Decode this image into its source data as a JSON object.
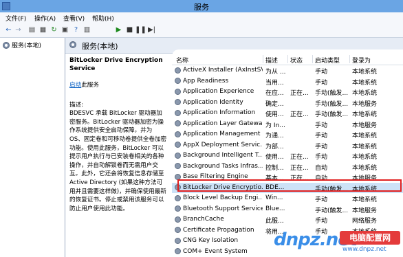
{
  "window": {
    "title": "服务"
  },
  "menu": [
    "文件(F)",
    "操作(A)",
    "查看(V)",
    "帮助(H)"
  ],
  "toolbar": [
    {
      "icon": "back-icon",
      "glyph": "←",
      "color": "#2f6cc0"
    },
    {
      "icon": "forward-icon",
      "glyph": "→",
      "color": "#8a9bb5"
    },
    {
      "icon": "console-tree-icon",
      "glyph": "▤",
      "color": "#444"
    },
    {
      "icon": "properties-icon",
      "glyph": "▦",
      "color": "#444"
    },
    {
      "icon": "refresh-icon",
      "glyph": "↻",
      "color": "#2e8b2e"
    },
    {
      "icon": "export-icon",
      "glyph": "▣",
      "color": "#444"
    },
    {
      "icon": "help-icon",
      "glyph": "?",
      "color": "#2f6cc0"
    },
    {
      "icon": "view-icon",
      "glyph": "▥",
      "color": "#444"
    },
    {
      "icon": "play-icon",
      "glyph": "▶",
      "color": "#1e8a1e"
    },
    {
      "icon": "stop-icon",
      "glyph": "■",
      "color": "#333"
    },
    {
      "icon": "pause-icon",
      "glyph": "❚❚",
      "color": "#333"
    },
    {
      "icon": "restart-icon",
      "glyph": "▶|",
      "color": "#333"
    }
  ],
  "tree": {
    "item": "服务(本地)"
  },
  "main": {
    "header": "服务(本地)"
  },
  "details": {
    "service_name": "BitLocker Drive Encryption Service",
    "start_link": "启动",
    "start_suffix": "此服务",
    "desc_label": "描述:",
    "description": "BDESVC 承载 BitLocker 驱动器加密服务。BitLocker 驱动器加密为操作系统提供安全启动保障，并为 OS、固定卷和可移动卷提供全卷加密功能。使用此服务，BitLocker 可以提示用户执行与已安装卷相关的各种操作，并自动解锁卷而无需用户交互。此外，它还会将恢复信息存储至 Active Directory (如果这种方法可用并且需要这样做)，并确保使用最新的恢复证书。停止或禁用该服务可以防止用户使用此功能。"
  },
  "columns": [
    "名称",
    "描述",
    "状态",
    "启动类型",
    "登录为"
  ],
  "services": [
    {
      "name": "ActiveX Installer (AxInstSV)",
      "desc": "为从 ...",
      "status": "",
      "startup": "手动",
      "logon": "本地系统"
    },
    {
      "name": "App Readiness",
      "desc": "当用...",
      "status": "",
      "startup": "手动",
      "logon": "本地系统"
    },
    {
      "name": "Application Experience",
      "desc": "在应...",
      "status": "正在...",
      "startup": "手动(触发...",
      "logon": "本地系统"
    },
    {
      "name": "Application Identity",
      "desc": "确定...",
      "status": "",
      "startup": "手动(触发...",
      "logon": "本地服务"
    },
    {
      "name": "Application Information",
      "desc": "使用...",
      "status": "正在...",
      "startup": "手动(触发...",
      "logon": "本地系统"
    },
    {
      "name": "Application Layer Gatewa...",
      "desc": "为 In...",
      "status": "",
      "startup": "手动",
      "logon": "本地服务"
    },
    {
      "name": "Application Management",
      "desc": "为通...",
      "status": "",
      "startup": "手动",
      "logon": "本地系统"
    },
    {
      "name": "AppX Deployment Servic...",
      "desc": "为部...",
      "status": "",
      "startup": "手动",
      "logon": "本地系统"
    },
    {
      "name": "Background Intelligent T...",
      "desc": "使用...",
      "status": "正在...",
      "startup": "手动",
      "logon": "本地系统"
    },
    {
      "name": "Background Tasks Infras...",
      "desc": "控制...",
      "status": "正在...",
      "startup": "自动",
      "logon": "本地系统"
    },
    {
      "name": "Base Filtering Engine",
      "desc": "基本...",
      "status": "正在...",
      "startup": "自动",
      "logon": "本地服务"
    },
    {
      "name": "BitLocker Drive Encryptio...",
      "desc": "BDE...",
      "status": "",
      "startup": "手动(触发...",
      "logon": "本地系统"
    },
    {
      "name": "Block Level Backup Engi...",
      "desc": "Win...",
      "status": "",
      "startup": "手动",
      "logon": "本地系统"
    },
    {
      "name": "Bluetooth Support Service",
      "desc": "Blue...",
      "status": "",
      "startup": "手动(触发...",
      "logon": "本地服务"
    },
    {
      "name": "BranchCache",
      "desc": "此服...",
      "status": "",
      "startup": "手动",
      "logon": "网络服务"
    },
    {
      "name": "Certificate Propagation",
      "desc": "将用...",
      "status": "",
      "startup": "手动",
      "logon": "本地系统"
    },
    {
      "name": "CNG Key Isolation",
      "desc": "",
      "status": "",
      "startup": "",
      "logon": ""
    },
    {
      "name": "COM+ Event System",
      "desc": "",
      "status": "",
      "startup": "",
      "logon": ""
    }
  ],
  "selected_index": 11,
  "watermark": {
    "text": "dnpz.net",
    "site": "电脑配置网",
    "url": "www.dnpz.net"
  },
  "colors": {
    "titlebar": "#6aa5e4",
    "selection": "#cde2f7",
    "highlight_box": "#e02020",
    "link": "#0b62c4"
  }
}
